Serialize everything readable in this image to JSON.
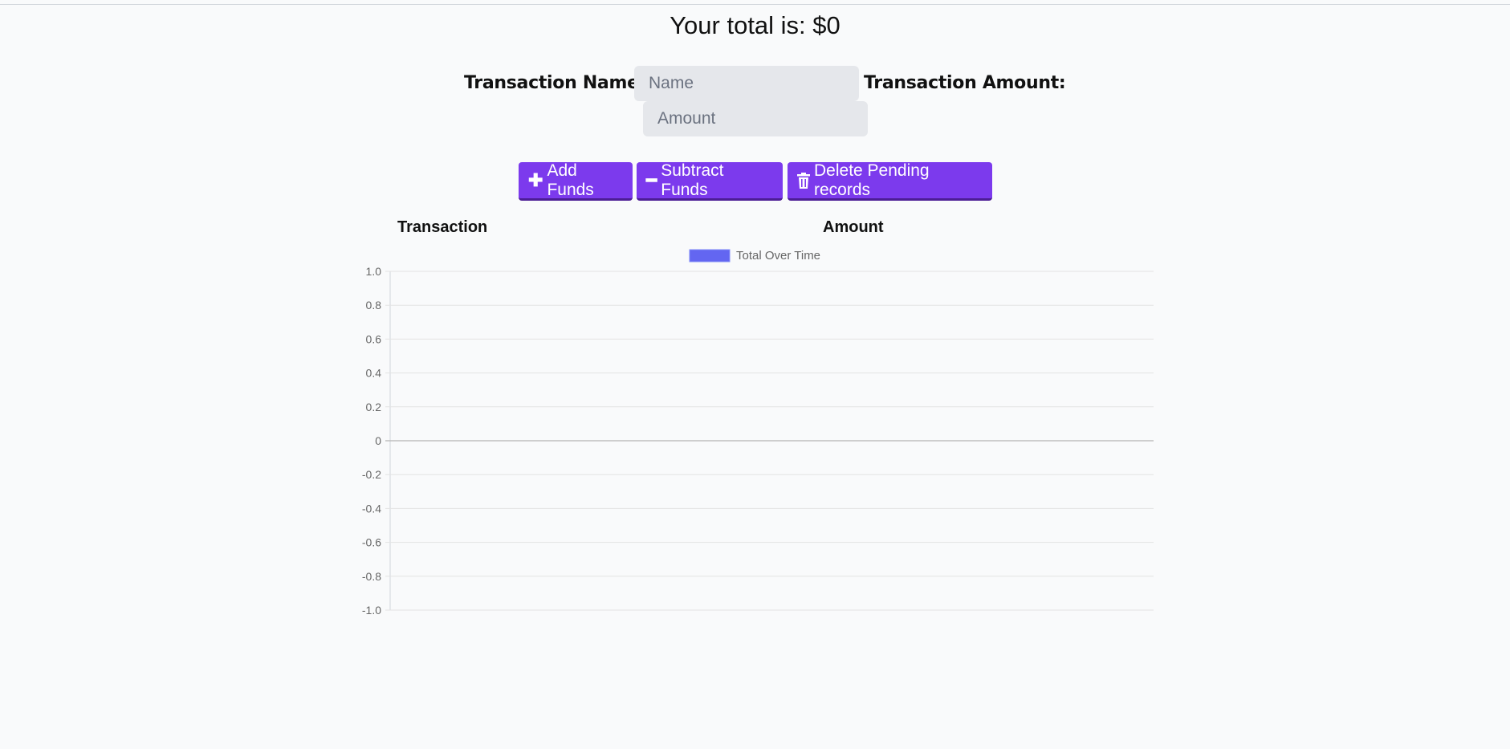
{
  "header": {
    "total_text": "Your total is: $0"
  },
  "form": {
    "name_label": "Transaction Name:",
    "name_placeholder": "Name",
    "amount_label": "Transaction Amount:",
    "amount_placeholder": "Amount"
  },
  "buttons": {
    "add": {
      "icon": "plus-icon",
      "glyph": "✚",
      "label": "Add Funds"
    },
    "subtract": {
      "icon": "minus-icon",
      "glyph": "━",
      "label": "Subtract Funds"
    },
    "delete": {
      "icon": "trash-icon",
      "label": "Delete Pending records"
    },
    "accent": "#7c3aed"
  },
  "table": {
    "headers": [
      "Transaction",
      "Amount"
    ],
    "rows": []
  },
  "chart_data": {
    "type": "line",
    "series": [
      {
        "name": "Total Over Time",
        "color": "#6366f1",
        "values": []
      }
    ],
    "x": [],
    "ylim": [
      -1.0,
      1.0
    ],
    "yticks": [
      "1.0",
      "0.8",
      "0.6",
      "0.4",
      "0.2",
      "0",
      "-0.2",
      "-0.4",
      "-0.6",
      "-0.8",
      "-1.0"
    ],
    "grid": true,
    "legend": "top"
  }
}
